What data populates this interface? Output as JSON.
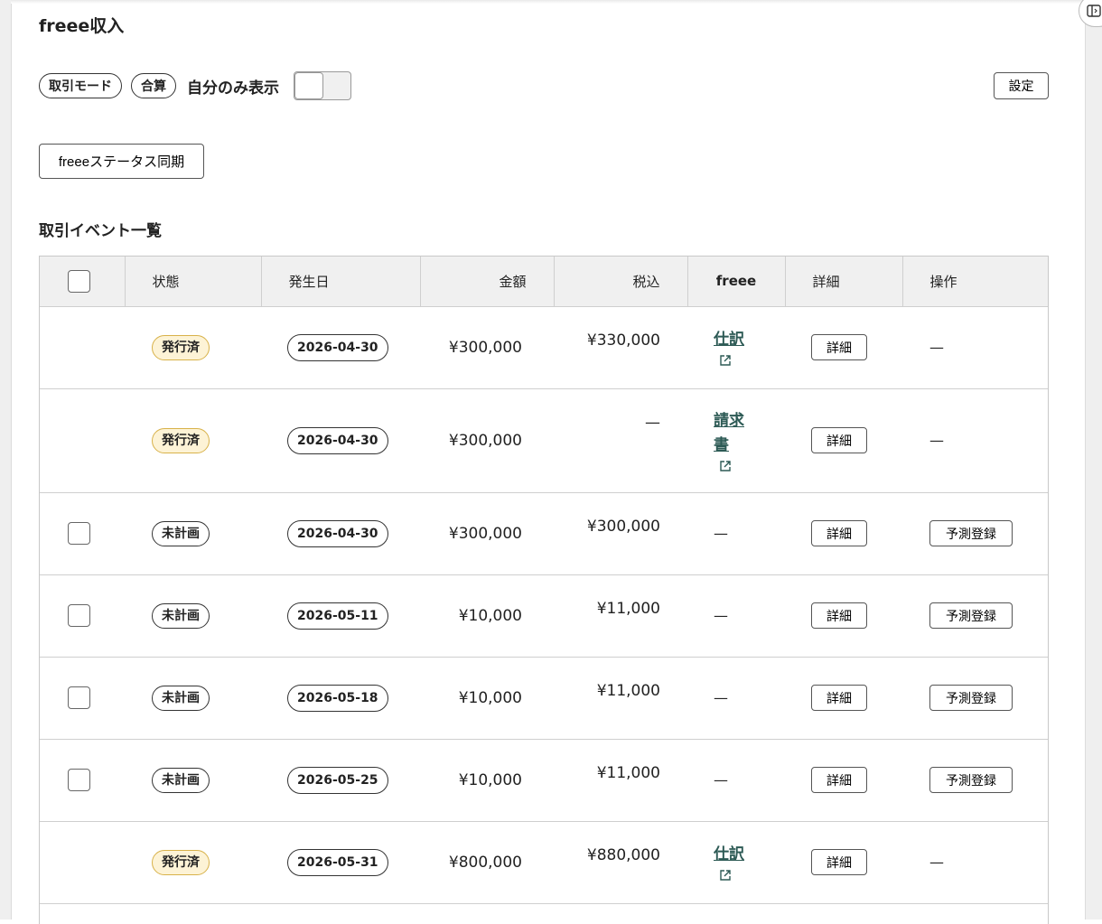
{
  "header": {
    "title": "freee収入"
  },
  "controls": {
    "mode_label": "取引モード",
    "sum_label": "合算",
    "mine_only_label": "自分のみ表示",
    "settings_label": "設定",
    "sync_label": "freeeステータス同期"
  },
  "section": {
    "title": "取引イベント一覧"
  },
  "table": {
    "headers": {
      "status": "状態",
      "date": "発生日",
      "amount": "金額",
      "tax": "税込",
      "freee": "freee",
      "detail": "詳細",
      "ops": "操作"
    },
    "rows": [
      {
        "checkbox": false,
        "status": "発行済",
        "status_type": "issued",
        "date": "2026-04-30",
        "amount": "¥300,000",
        "tax": "¥330,000",
        "freee": "仕訳",
        "freee_link": true,
        "detail": "詳細",
        "op": "—"
      },
      {
        "checkbox": false,
        "status": "発行済",
        "status_type": "issued",
        "date": "2026-04-30",
        "amount": "¥300,000",
        "tax": "—",
        "freee": "請求書",
        "freee_link": true,
        "detail": "詳細",
        "op": "—"
      },
      {
        "checkbox": true,
        "status": "未計画",
        "status_type": "planned",
        "date": "2026-04-30",
        "amount": "¥300,000",
        "tax": "¥300,000",
        "freee": "—",
        "freee_link": false,
        "detail": "詳細",
        "op": "予測登録"
      },
      {
        "checkbox": true,
        "status": "未計画",
        "status_type": "planned",
        "date": "2026-05-11",
        "amount": "¥10,000",
        "tax": "¥11,000",
        "freee": "—",
        "freee_link": false,
        "detail": "詳細",
        "op": "予測登録"
      },
      {
        "checkbox": true,
        "status": "未計画",
        "status_type": "planned",
        "date": "2026-05-18",
        "amount": "¥10,000",
        "tax": "¥11,000",
        "freee": "—",
        "freee_link": false,
        "detail": "詳細",
        "op": "予測登録"
      },
      {
        "checkbox": true,
        "status": "未計画",
        "status_type": "planned",
        "date": "2026-05-25",
        "amount": "¥10,000",
        "tax": "¥11,000",
        "freee": "—",
        "freee_link": false,
        "detail": "詳細",
        "op": "予測登録"
      },
      {
        "checkbox": false,
        "status": "発行済",
        "status_type": "issued",
        "date": "2026-05-31",
        "amount": "¥800,000",
        "tax": "¥880,000",
        "freee": "仕訳",
        "freee_link": true,
        "detail": "詳細",
        "op": "—"
      }
    ]
  },
  "icons": {
    "panel": "panel-toggle-icon",
    "external": "external-link-icon"
  },
  "colors": {
    "issued_bg": "#fdf3d6",
    "issued_border": "#d8b24a",
    "link": "#2d5a55"
  }
}
